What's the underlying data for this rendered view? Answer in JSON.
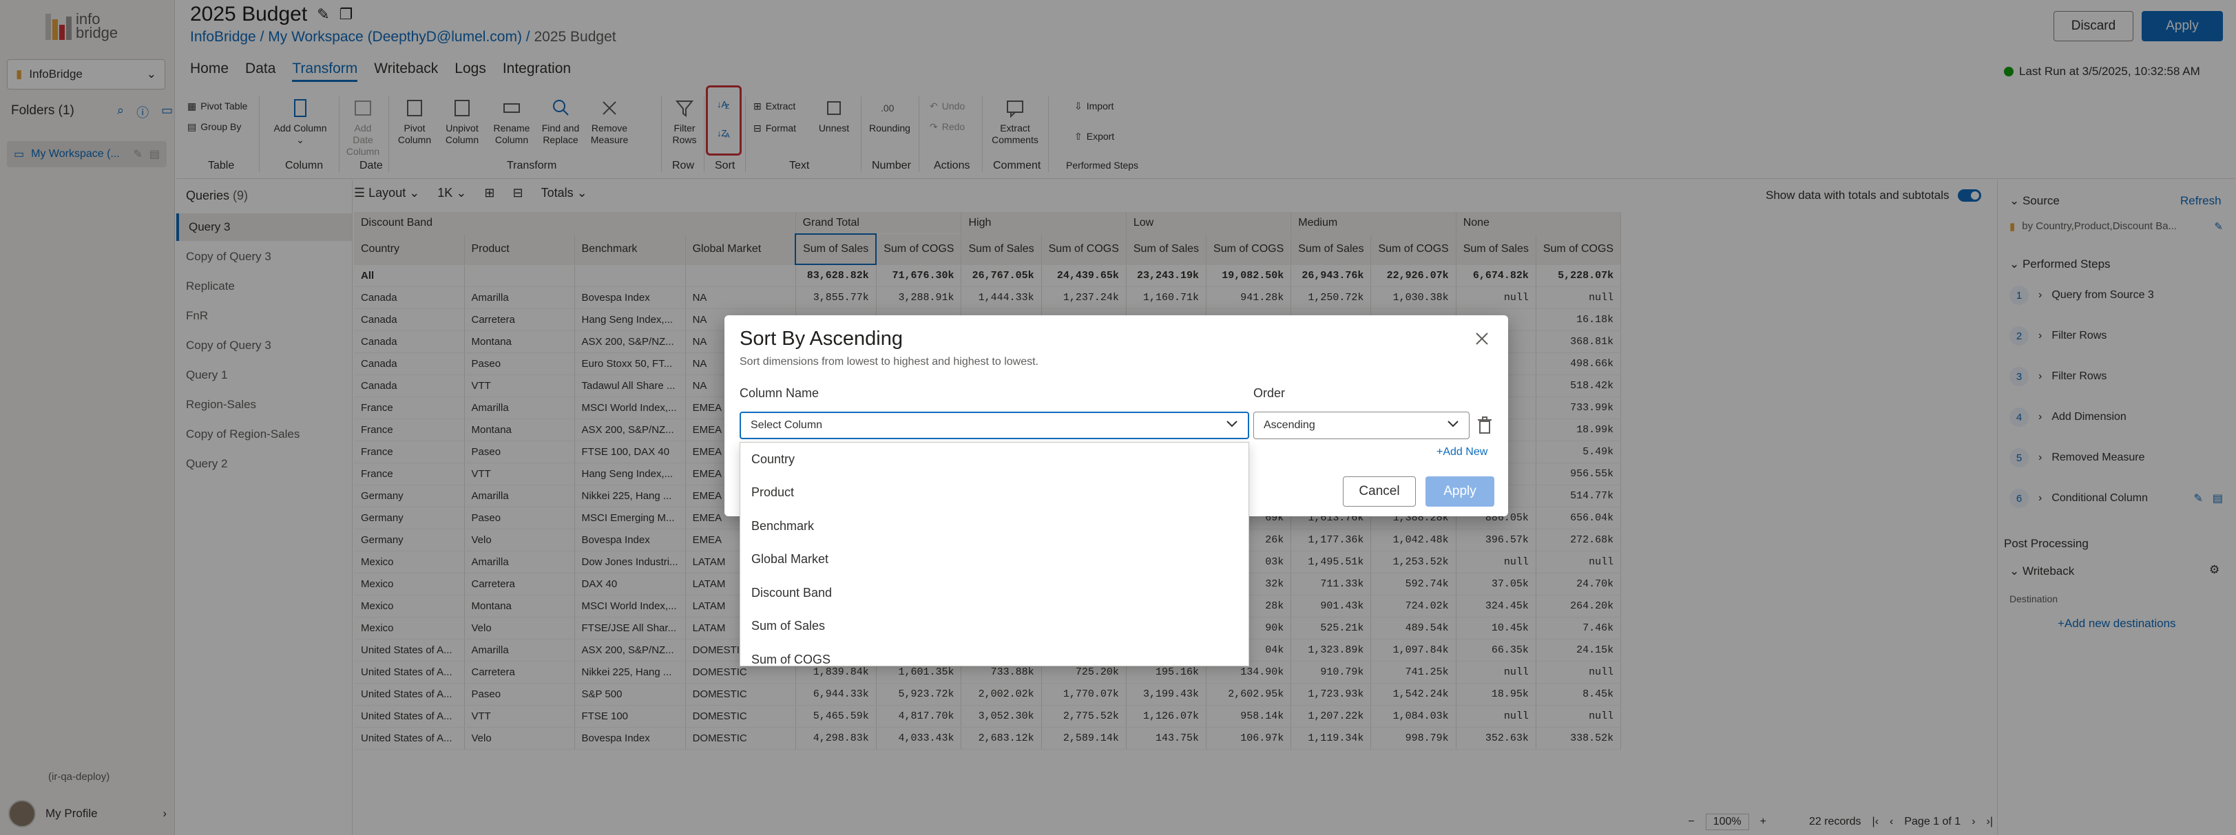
{
  "app": {
    "logo_text": "info bridge",
    "app_selector": "InfoBridge",
    "folders_label": "Folders (1)",
    "workspace_item": "My Workspace (...",
    "env": "(ir-qa-deploy)",
    "profile": "My Profile"
  },
  "header": {
    "title": "2025 Budget",
    "crumb_app": "InfoBridge",
    "crumb_sep": " / ",
    "crumb_workspace": "My Workspace (DeepthyD@lumel.com)",
    "crumb_current": "2025 Budget",
    "discard": "Discard",
    "apply": "Apply",
    "last_run": "Last Run at 3/5/2025, 10:32:58 AM"
  },
  "menu": {
    "items": [
      "Home",
      "Data",
      "Transform",
      "Writeback",
      "Logs",
      "Integration"
    ],
    "selected": "Transform"
  },
  "ribbon": {
    "pivot_table": "Pivot Table",
    "group_by": "Group By",
    "add_column": "Add Column",
    "add_date_column": "Add Date Column",
    "pivot_column": "Pivot Column",
    "unpivot_column": "Unpivot Column",
    "rename_column": "Rename Column",
    "find_replace": "Find and Replace",
    "remove_measure": "Remove Measure",
    "filter_rows": "Filter Rows",
    "extract": "Extract",
    "format": "Format",
    "unnest": "Unnest",
    "rounding": "Rounding",
    "undo": "Undo",
    "redo": "Redo",
    "extract_comments": "Extract Comments",
    "import": "Import",
    "export": "Export",
    "groups": [
      "Table",
      "Column",
      "Date",
      "Transform",
      "Row",
      "Sort",
      "Text",
      "Number",
      "Actions",
      "Comment",
      "Performed Steps"
    ]
  },
  "queries": {
    "label": "Queries",
    "count": "(9)",
    "items": [
      "Query 3",
      "Copy of Query 3",
      "Replicate",
      "FnR",
      "Copy of Query 3",
      "Query 1",
      "Region-Sales",
      "Copy of Region-Sales",
      "Query 2"
    ],
    "selected": "Query 3"
  },
  "grid_toolbar": {
    "layout": "Layout",
    "page_size": "1K",
    "totals": "Totals",
    "show_data": "Show data with totals and subtotals"
  },
  "table": {
    "group_header": [
      "Discount Band",
      "Grand Total",
      "High",
      "Low",
      "Medium",
      "None"
    ],
    "dims": [
      "Country",
      "Product",
      "Benchmark",
      "Global Market"
    ],
    "measures": [
      "Sum of Sales",
      "Sum of COGS"
    ],
    "rows": [
      [
        "All",
        "",
        "",
        "",
        "83,628.82k",
        "71,676.30k",
        "26,767.05k",
        "24,439.65k",
        "23,243.19k",
        "19,082.50k",
        "26,943.76k",
        "22,926.07k",
        "6,674.82k",
        "5,228.07k"
      ],
      [
        "Canada",
        "Amarilla",
        "Bovespa Index",
        "NA",
        "3,855.77k",
        "3,288.91k",
        "1,444.33k",
        "1,237.24k",
        "1,160.71k",
        "941.28k",
        "1,250.72k",
        "1,030.38k",
        "null",
        "null"
      ],
      [
        "Canada",
        "Carretera",
        "Hang Seng Index,...",
        "NA",
        "",
        "",
        "",
        "",
        "",
        "",
        "",
        "",
        "",
        "16.18k"
      ],
      [
        "Canada",
        "Montana",
        "ASX 200, S&P/NZ...",
        "NA",
        "",
        "",
        "",
        "",
        "",
        "",
        "",
        "",
        "",
        "368.81k"
      ],
      [
        "Canada",
        "Paseo",
        "Euro Stoxx 50, FT...",
        "NA",
        "",
        "",
        "",
        "",
        "",
        "",
        "",
        "",
        "",
        "498.66k"
      ],
      [
        "Canada",
        "VTT",
        "Tadawul All Share ...",
        "NA",
        "",
        "",
        "",
        "",
        "",
        "",
        "",
        "",
        "",
        "518.42k"
      ],
      [
        "France",
        "Amarilla",
        "MSCI World Index,...",
        "EMEA",
        "",
        "",
        "",
        "",
        "",
        "",
        "",
        "",
        "",
        "733.99k"
      ],
      [
        "France",
        "Montana",
        "ASX 200, S&P/NZ...",
        "EMEA",
        "",
        "",
        "",
        "",
        "",
        "",
        "",
        "",
        "",
        "18.99k"
      ],
      [
        "France",
        "Paseo",
        "FTSE 100, DAX 40",
        "EMEA",
        "",
        "",
        "",
        "",
        "",
        "",
        "",
        "",
        "",
        "5.49k"
      ],
      [
        "France",
        "VTT",
        "Hang Seng Index,...",
        "EMEA",
        "",
        "",
        "",
        "",
        "",
        "",
        "",
        "",
        "",
        "956.55k"
      ],
      [
        "Germany",
        "Amarilla",
        "Nikkei 225, Hang ...",
        "EMEA",
        "",
        "",
        "",
        "",
        "",
        "",
        "",
        "",
        "",
        "514.77k"
      ],
      [
        "Germany",
        "Paseo",
        "MSCI Emerging M...",
        "EMEA",
        "",
        "",
        "",
        "",
        "",
        "69k",
        "1,613.76k",
        "1,388.28k",
        "886.05k",
        "656.04k"
      ],
      [
        "Germany",
        "Velo",
        "Bovespa Index",
        "EMEA",
        "",
        "",
        "",
        "",
        "",
        "26k",
        "1,177.36k",
        "1,042.48k",
        "396.57k",
        "272.68k"
      ],
      [
        "Mexico",
        "Amarilla",
        "Dow Jones Industri...",
        "LATAM",
        "",
        "",
        "",
        "",
        "",
        "03k",
        "1,495.51k",
        "1,253.52k",
        "null",
        "null"
      ],
      [
        "Mexico",
        "Carretera",
        "DAX 40",
        "LATAM",
        "",
        "",
        "",
        "",
        "",
        "32k",
        "711.33k",
        "592.74k",
        "37.05k",
        "24.70k"
      ],
      [
        "Mexico",
        "Montana",
        "MSCI World Index,...",
        "LATAM",
        "",
        "",
        "",
        "",
        "",
        "28k",
        "901.43k",
        "724.02k",
        "324.45k",
        "264.20k"
      ],
      [
        "Mexico",
        "Velo",
        "FTSE/JSE All Shar...",
        "LATAM",
        "",
        "",
        "",
        "",
        "",
        "90k",
        "525.21k",
        "489.54k",
        "10.45k",
        "7.46k"
      ],
      [
        "United States of A...",
        "Amarilla",
        "ASX 200, S&P/NZ...",
        "DOMESTIC",
        "",
        "",
        "",
        "",
        "",
        "04k",
        "1,323.89k",
        "1,097.84k",
        "66.35k",
        "24.15k"
      ],
      [
        "United States of A...",
        "Carretera",
        "Nikkei 225, Hang ...",
        "DOMESTIC",
        "1,839.84k",
        "1,601.35k",
        "733.88k",
        "725.20k",
        "195.16k",
        "134.90k",
        "910.79k",
        "741.25k",
        "null",
        "null"
      ],
      [
        "United States of A...",
        "Paseo",
        "S&P 500",
        "DOMESTIC",
        "6,944.33k",
        "5,923.72k",
        "2,002.02k",
        "1,770.07k",
        "3,199.43k",
        "2,602.95k",
        "1,723.93k",
        "1,542.24k",
        "18.95k",
        "8.45k"
      ],
      [
        "United States of A...",
        "VTT",
        "FTSE 100",
        "DOMESTIC",
        "5,465.59k",
        "4,817.70k",
        "3,052.30k",
        "2,775.52k",
        "1,126.07k",
        "958.14k",
        "1,207.22k",
        "1,084.03k",
        "null",
        "null"
      ],
      [
        "United States of A...",
        "Velo",
        "Bovespa Index",
        "DOMESTIC",
        "4,298.83k",
        "4,033.43k",
        "2,683.12k",
        "2,589.14k",
        "143.75k",
        "106.97k",
        "1,119.34k",
        "998.79k",
        "352.63k",
        "338.52k"
      ]
    ]
  },
  "footer": {
    "zoom": "100%",
    "records": "22 records",
    "page": "Page 1 of 1"
  },
  "right_panel": {
    "source_label": "Source",
    "refresh": "Refresh",
    "source_desc": "by Country,Product,Discount Ba...",
    "performed_steps": "Performed Steps",
    "steps": [
      {
        "n": "1",
        "label": "Query from Source 3"
      },
      {
        "n": "2",
        "label": "Filter Rows"
      },
      {
        "n": "3",
        "label": "Filter Rows"
      },
      {
        "n": "4",
        "label": "Add Dimension"
      },
      {
        "n": "5",
        "label": "Removed Measure"
      },
      {
        "n": "6",
        "label": "Conditional Column"
      }
    ],
    "post_processing": "Post Processing",
    "writeback": "Writeback",
    "destination": "Destination",
    "add_destination": "+Add new destinations"
  },
  "dialog": {
    "title": "Sort By Ascending",
    "subtitle": "Sort dimensions from lowest to highest and highest to lowest.",
    "column_label": "Column Name",
    "order_label": "Order",
    "column_placeholder": "Select Column",
    "order_value": "Ascending",
    "add_new": "+Add New",
    "cancel": "Cancel",
    "apply": "Apply",
    "options": [
      "Country",
      "Product",
      "Benchmark",
      "Global Market",
      "Discount Band",
      "Sum of Sales",
      "Sum of COGS"
    ]
  },
  "colors": {
    "accent": "#0f6cbd",
    "highlight": "#d13438",
    "success": "#13a10e"
  }
}
